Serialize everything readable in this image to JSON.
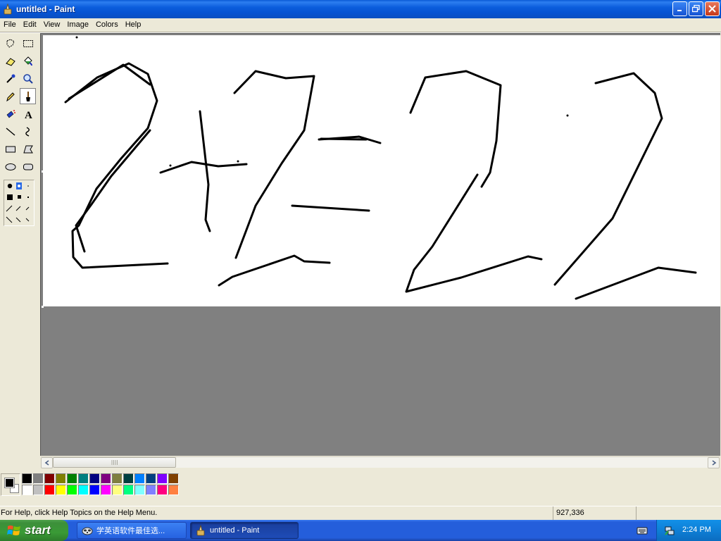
{
  "window": {
    "title": "untitled - Paint"
  },
  "menu": [
    "File",
    "Edit",
    "View",
    "Image",
    "Colors",
    "Help"
  ],
  "tools": [
    "free-form-select",
    "select",
    "eraser",
    "fill-with-color",
    "pick-color",
    "magnifier",
    "pencil",
    "brush",
    "airbrush",
    "text",
    "line",
    "curve",
    "rectangle",
    "polygon",
    "ellipse",
    "rounded-rectangle"
  ],
  "selected_tool": "brush",
  "palette": {
    "foreground": "#000000",
    "background": "#ffffff",
    "colors": [
      "#000000",
      "#808080",
      "#800000",
      "#808000",
      "#008000",
      "#008080",
      "#000080",
      "#800080",
      "#808040",
      "#004040",
      "#0080ff",
      "#004080",
      "#8000ff",
      "#804000",
      "#ffffff",
      "#c0c0c0",
      "#ff0000",
      "#ffff00",
      "#00ff00",
      "#00ffff",
      "#0000ff",
      "#ff00ff",
      "#ffff80",
      "#00ff80",
      "#80ffff",
      "#8080ff",
      "#ff0080",
      "#ff8040"
    ]
  },
  "status": {
    "help": "For Help, click Help Topics on the Help Menu.",
    "coords": "927,336"
  },
  "taskbar": {
    "start_label": "start",
    "tasks": [
      {
        "label": "学英语软件最佳选...",
        "active": false
      },
      {
        "label": "untitled - Paint",
        "active": true
      }
    ],
    "clock": "2:24 PM"
  },
  "colors": {
    "titlebar": "#0a5ad6",
    "taskbar": "#245edb",
    "start_button": "#3c8f3a",
    "workspace": "#808080"
  }
}
